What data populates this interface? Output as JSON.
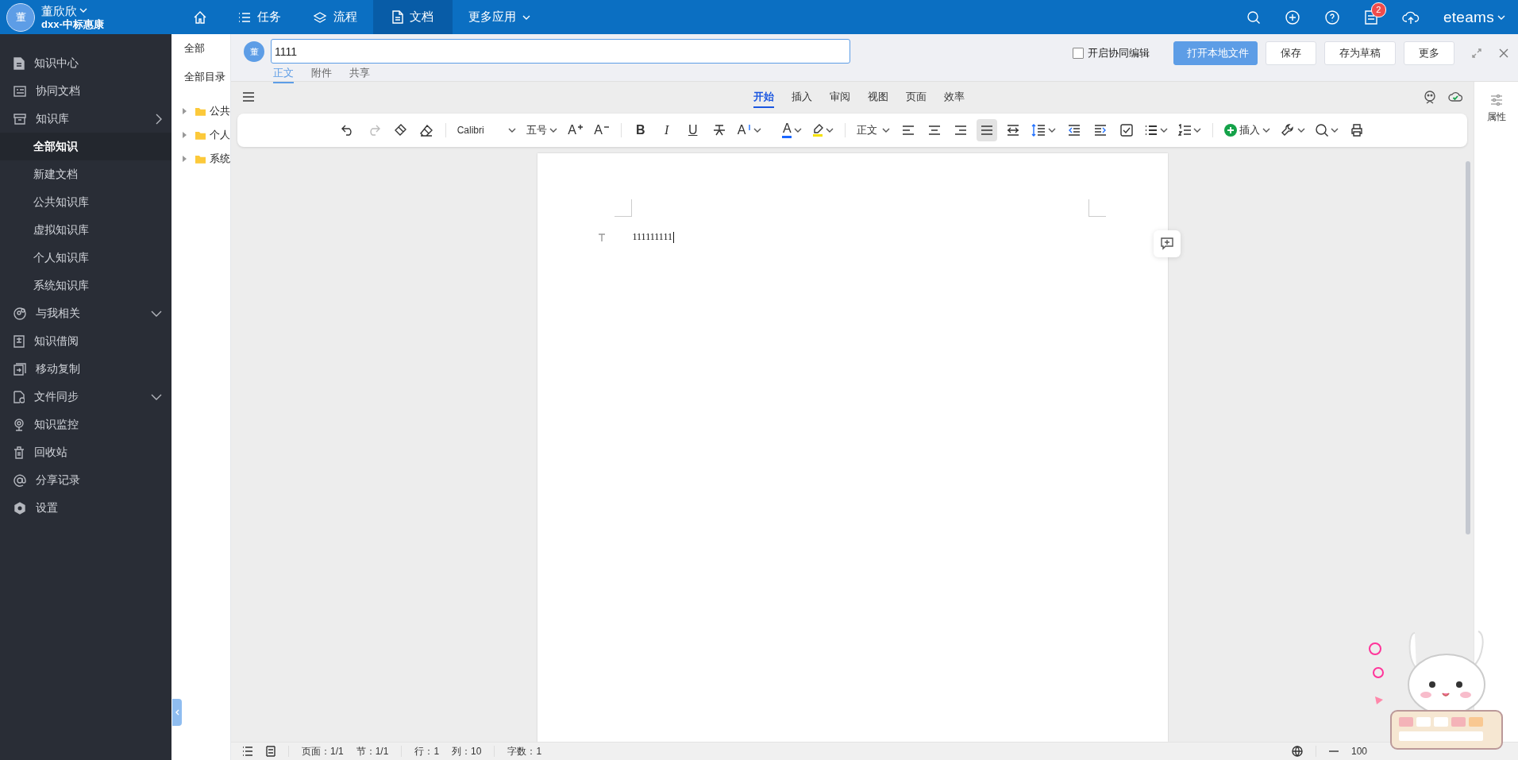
{
  "top_bar": {
    "avatar": "董",
    "user_name": "董欣欣",
    "org": "dxx-中标惠康",
    "nav": [
      {
        "kind": "home",
        "selected": false
      },
      {
        "kind": "tasks",
        "label": "任务",
        "selected": false
      },
      {
        "kind": "flow",
        "label": "流程",
        "selected": false
      },
      {
        "kind": "docs",
        "label": "文档",
        "selected": true
      },
      {
        "kind": "more",
        "label": "更多应用",
        "selected": false
      }
    ],
    "notification_count": "2",
    "brand": "eteams"
  },
  "sidebar": {
    "items": [
      {
        "label": "知识中心"
      },
      {
        "label": "协同文档"
      },
      {
        "label": "知识库",
        "expanded": false,
        "children": [
          {
            "label": "全部知识",
            "selected": true
          },
          {
            "label": "新建文档",
            "selected": false
          },
          {
            "label": "公共知识库",
            "selected": false
          },
          {
            "label": "虚拟知识库",
            "selected": false
          },
          {
            "label": "个人知识库",
            "selected": false
          },
          {
            "label": "系统知识库",
            "selected": false
          }
        ]
      },
      {
        "label": "与我相关",
        "expanded": true
      },
      {
        "label": "知识借阅"
      },
      {
        "label": "移动复制"
      },
      {
        "label": "文件同步",
        "expanded": true
      },
      {
        "label": "知识监控"
      },
      {
        "label": "回收站"
      },
      {
        "label": "分享记录"
      },
      {
        "label": "设置"
      }
    ]
  },
  "tree": {
    "tabs": [
      "全部",
      "全部目录"
    ],
    "nodes": [
      {
        "label": "公共"
      },
      {
        "label": "个人"
      },
      {
        "label": "系统"
      }
    ]
  },
  "document": {
    "avatar": "董",
    "title": "1111",
    "tabs": [
      {
        "label": "正文",
        "selected": true
      },
      {
        "label": "附件",
        "selected": false
      },
      {
        "label": "共享",
        "selected": false
      }
    ],
    "co_edit": {
      "label": "开启协同编辑",
      "checked": false
    },
    "buttons": [
      {
        "label": "打开本地文件",
        "primary": true
      },
      {
        "label": "保存",
        "primary": false
      },
      {
        "label": "存为草稿",
        "primary": false
      },
      {
        "label": "更多",
        "primary": false
      }
    ]
  },
  "editor": {
    "menu": [
      {
        "label": "开始",
        "selected": true
      },
      {
        "label": "插入",
        "selected": false
      },
      {
        "label": "审阅",
        "selected": false
      },
      {
        "label": "视图",
        "selected": false
      },
      {
        "label": "页面",
        "selected": false
      },
      {
        "label": "效率",
        "selected": false
      }
    ],
    "toolbar": {
      "font": "Calibri",
      "size": "五号",
      "grow": "A",
      "shrink": "A",
      "bold": "B",
      "italic": "I",
      "underline": "U",
      "case": "A",
      "font_color": "A",
      "style": "正文",
      "alignments": [
        {
          "selected": false
        },
        {
          "selected": false
        },
        {
          "selected": false
        },
        {
          "selected": true
        }
      ],
      "insert": "插入"
    },
    "paragraphs": [
      "111111111"
    ],
    "properties": "属性"
  },
  "status_bar": {
    "page": "页面：1/1",
    "section": "节：1/1",
    "line": "行：1",
    "column": "列：10",
    "words": "字数：1",
    "zoom": "100"
  }
}
